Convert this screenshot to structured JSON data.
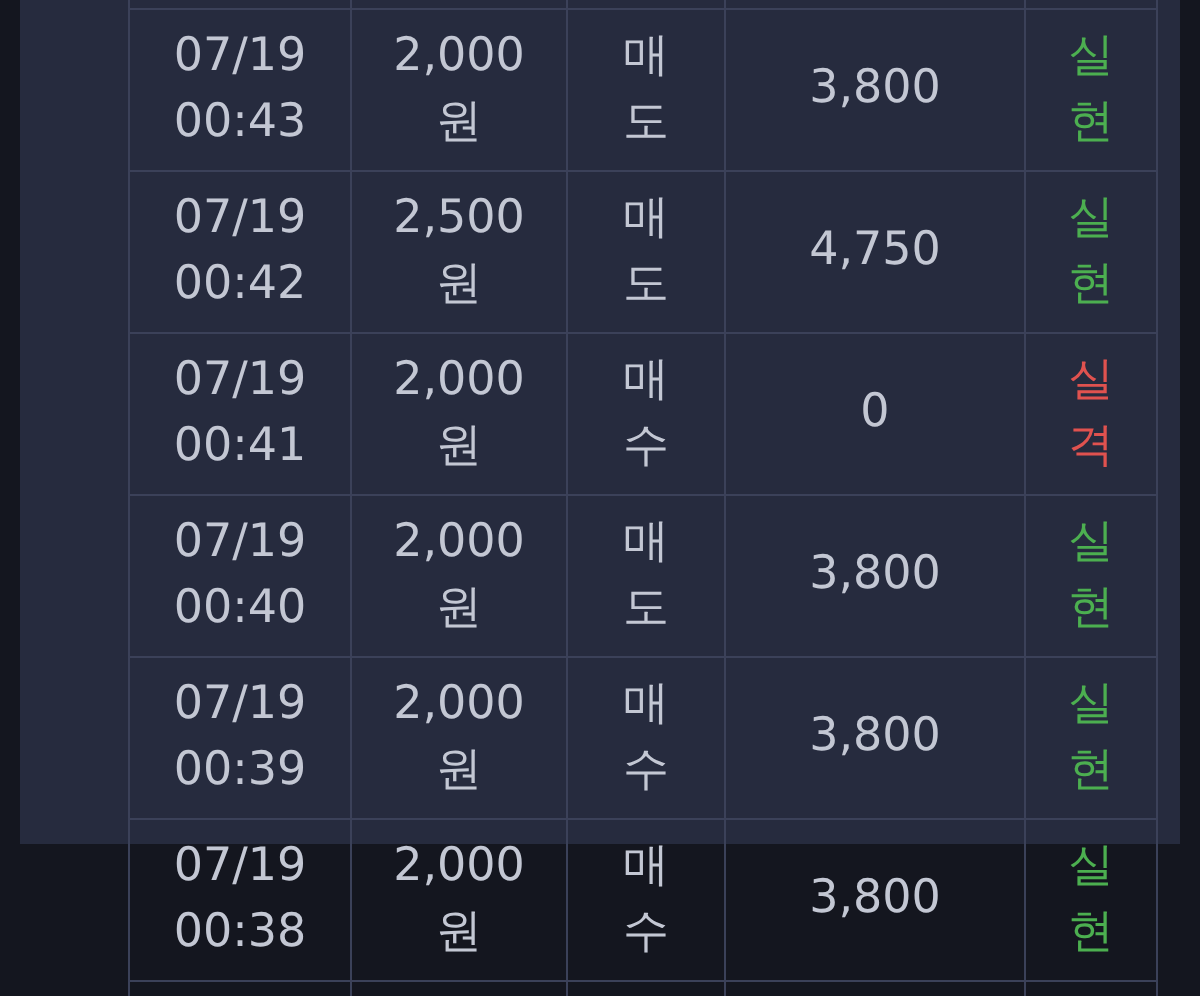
{
  "rows": [
    {
      "time": "07/19 00:43",
      "amount": "2,000 원",
      "side": "매도",
      "price": "3,800",
      "result": "실현",
      "color": "#4caf50"
    },
    {
      "time": "07/19 00:42",
      "amount": "2,500 원",
      "side": "매도",
      "price": "4,750",
      "result": "실현",
      "color": "#4caf50"
    },
    {
      "time": "07/19 00:41",
      "amount": "2,000 원",
      "side": "매수",
      "price": "0",
      "result": "실격",
      "color": "#e0524f"
    },
    {
      "time": "07/19 00:40",
      "amount": "2,000 원",
      "side": "매도",
      "price": "3,800",
      "result": "실현",
      "color": "#4caf50"
    },
    {
      "time": "07/19 00:39",
      "amount": "2,000 원",
      "side": "매수",
      "price": "3,800",
      "result": "실현",
      "color": "#4caf50"
    },
    {
      "time": "07/19 00:38",
      "amount": "2,000 원",
      "side": "매수",
      "price": "3,800",
      "result": "실현",
      "color": "#4caf50"
    }
  ]
}
